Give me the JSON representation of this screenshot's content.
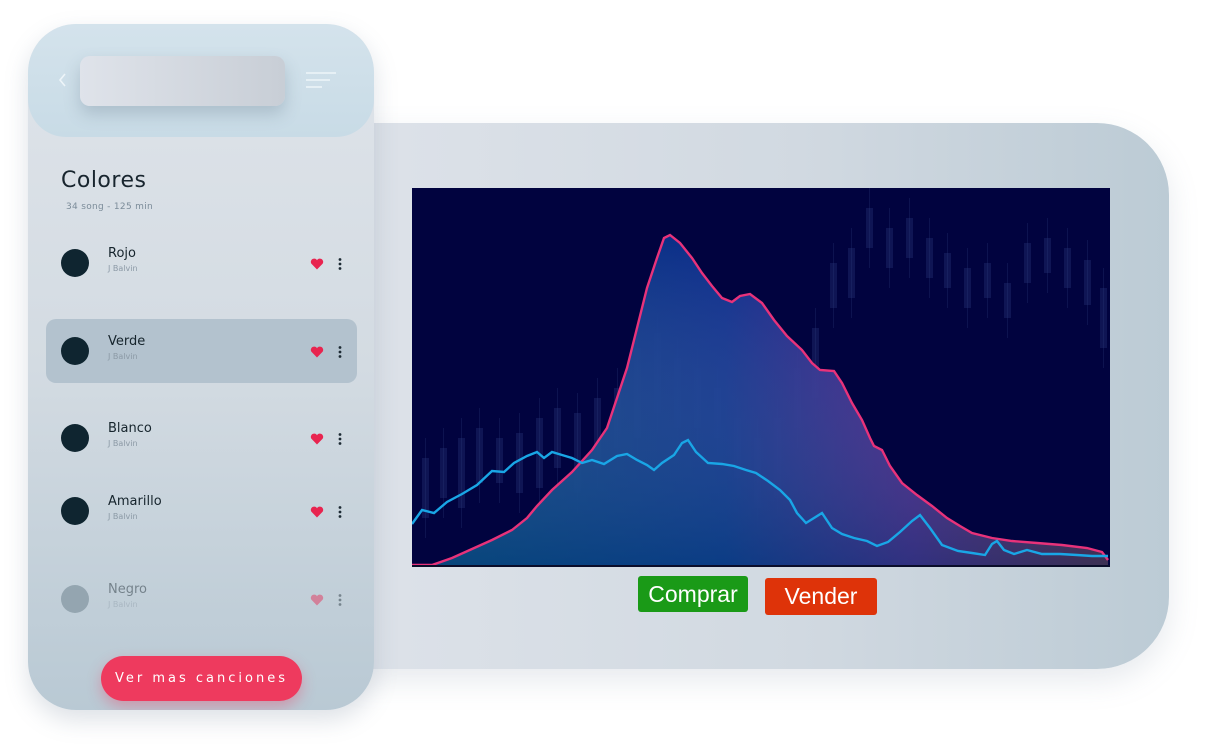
{
  "playlist": {
    "title": "Colores",
    "subtitle": "34 song - 125 min",
    "songs": [
      {
        "name": "Rojo",
        "artist": "J Balvin"
      },
      {
        "name": "Verde",
        "artist": "J Balvin"
      },
      {
        "name": "Blanco",
        "artist": "J Balvin"
      },
      {
        "name": "Amarillo",
        "artist": "J Balvin"
      },
      {
        "name": "Negro",
        "artist": "J Balvin"
      }
    ],
    "selected_song": "Verde",
    "cta_label": "Ver mas canciones"
  },
  "trading": {
    "buy_label": "Comprar",
    "sell_label": "Vender"
  },
  "colors": {
    "accent_pink": "#ee3a5e",
    "heart": "#e8244f",
    "buy_green": "#1a9a17",
    "sell_red": "#de3309",
    "chart_background": "#01033f",
    "line_pink": "#e8327a",
    "line_blue": "#19a6e6"
  },
  "icons": [
    "back-icon",
    "menu-icon",
    "heart-icon",
    "more-icon"
  ]
}
